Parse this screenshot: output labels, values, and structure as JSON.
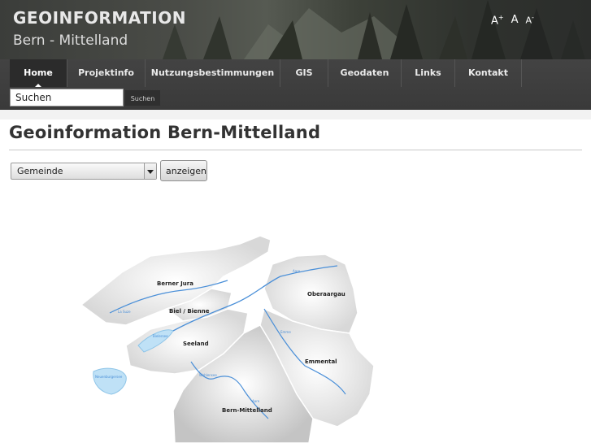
{
  "header": {
    "title": "GEOINFORMATION",
    "subtitle": "Bern - Mittelland",
    "font_controls": [
      "A+",
      "A",
      "A-"
    ]
  },
  "nav": {
    "items": [
      {
        "label": "Home",
        "active": true
      },
      {
        "label": "Projektinfo"
      },
      {
        "label": "Nutzungsbestimmungen"
      },
      {
        "label": "GIS"
      },
      {
        "label": "Geodaten"
      },
      {
        "label": "Links"
      },
      {
        "label": "Kontakt"
      }
    ]
  },
  "search": {
    "value": "Suchen",
    "button_label": "Suchen"
  },
  "main": {
    "title": "Geoinformation Bern-Mittelland",
    "select_value": "Gemeinde",
    "show_button": "anzeigen"
  },
  "map": {
    "regions": [
      "Berner Jura",
      "Biel / Bienne",
      "Seeland",
      "Oberaargau",
      "Emmental",
      "Bern-Mittelland"
    ],
    "water_labels": [
      "La Suze",
      "Aare",
      "Emme",
      "Bielersee",
      "Neuenburgersee",
      "Wohlensee",
      "Aare"
    ]
  }
}
